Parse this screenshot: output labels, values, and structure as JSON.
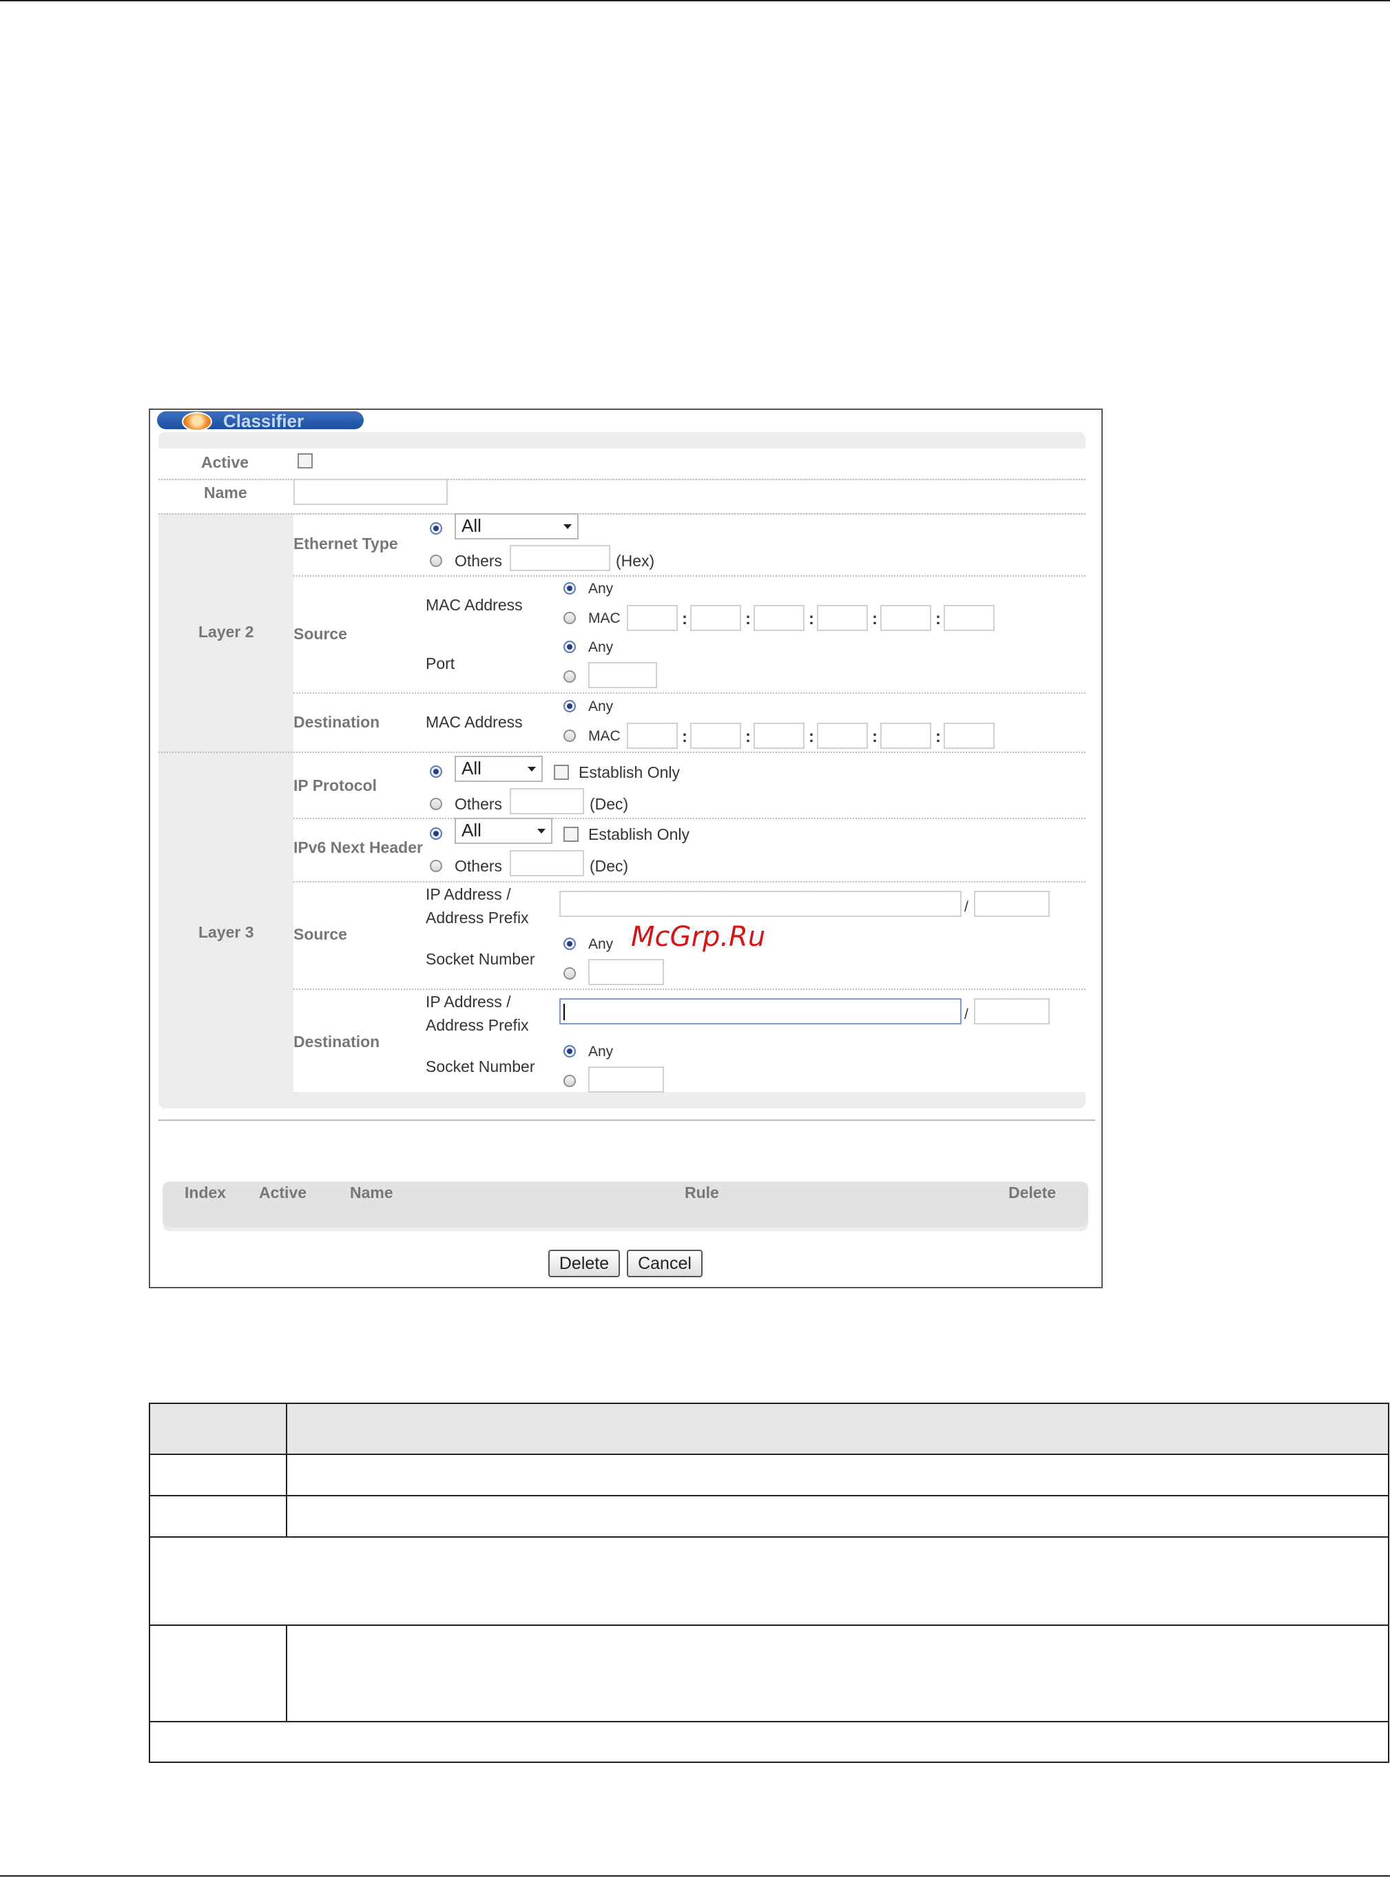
{
  "classifier": {
    "title": "Classifier",
    "active_label": "Active",
    "name_label": "Name",
    "layer2": {
      "label": "Layer 2",
      "ethernet_type_label": "Ethernet Type",
      "ethernet_select": "All",
      "others_label": "Others",
      "hex_label": "(Hex)",
      "source_label": "Source",
      "mac_address_label": "MAC Address",
      "any_label": "Any",
      "mac_label": "MAC",
      "port_label": "Port",
      "destination_label": "Destination"
    },
    "layer3": {
      "label": "Layer 3",
      "ip_protocol_label": "IP Protocol",
      "ip_protocol_select": "All",
      "establish_only_label": "Establish Only",
      "ipv6_next_header_label": "IPv6 Next Header",
      "ipv6_select": "All",
      "others_label": "Others",
      "dec_label": "(Dec)",
      "source_label": "Source",
      "ip_address_label": "IP Address /",
      "address_prefix_label": "Address Prefix",
      "socket_number_label": "Socket Number",
      "any_label": "Any",
      "slash": "/",
      "destination_label": "Destination"
    },
    "colon": ":",
    "list_headers": [
      "Index",
      "Active",
      "Name",
      "Rule",
      "Delete"
    ],
    "buttons": {
      "delete": "Delete",
      "cancel": "Cancel"
    }
  },
  "watermark": "McGrp.Ru"
}
